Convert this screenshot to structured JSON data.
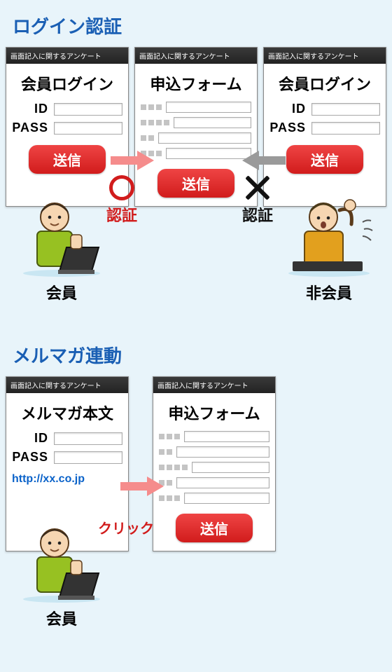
{
  "section1": {
    "title": "ログイン認証",
    "panels": {
      "member_login": {
        "top_bar": "画面記入に関するアンケート",
        "title": "会員ログイン",
        "id_label": "ID",
        "pass_label": "PASS",
        "submit": "送信"
      },
      "app_form": {
        "top_bar": "画面記入に関するアンケート",
        "title": "申込フォーム",
        "submit": "送信"
      },
      "nonmember_login": {
        "top_bar": "画面記入に関するアンケート",
        "title": "会員ログイン",
        "id_label": "ID",
        "pass_label": "PASS",
        "submit": "送信"
      }
    },
    "auth_ok_label": "認証",
    "auth_ng_label": "認証",
    "member_caption": "会員",
    "nonmember_caption": "非会員"
  },
  "section2": {
    "title": "メルマガ連動",
    "panels": {
      "mailmag": {
        "top_bar": "画面記入に関するアンケート",
        "title": "メルマガ本文",
        "id_label": "ID",
        "pass_label": "PASS",
        "link": "http://xx.co.jp"
      },
      "app_form": {
        "top_bar": "画面記入に関するアンケート",
        "title": "申込フォーム",
        "submit": "送信"
      }
    },
    "click_label": "クリック",
    "member_caption": "会員"
  },
  "colors": {
    "arrow_pink": "#f58c8c",
    "arrow_gray": "#9a9a9a",
    "red": "#d11c1c"
  }
}
